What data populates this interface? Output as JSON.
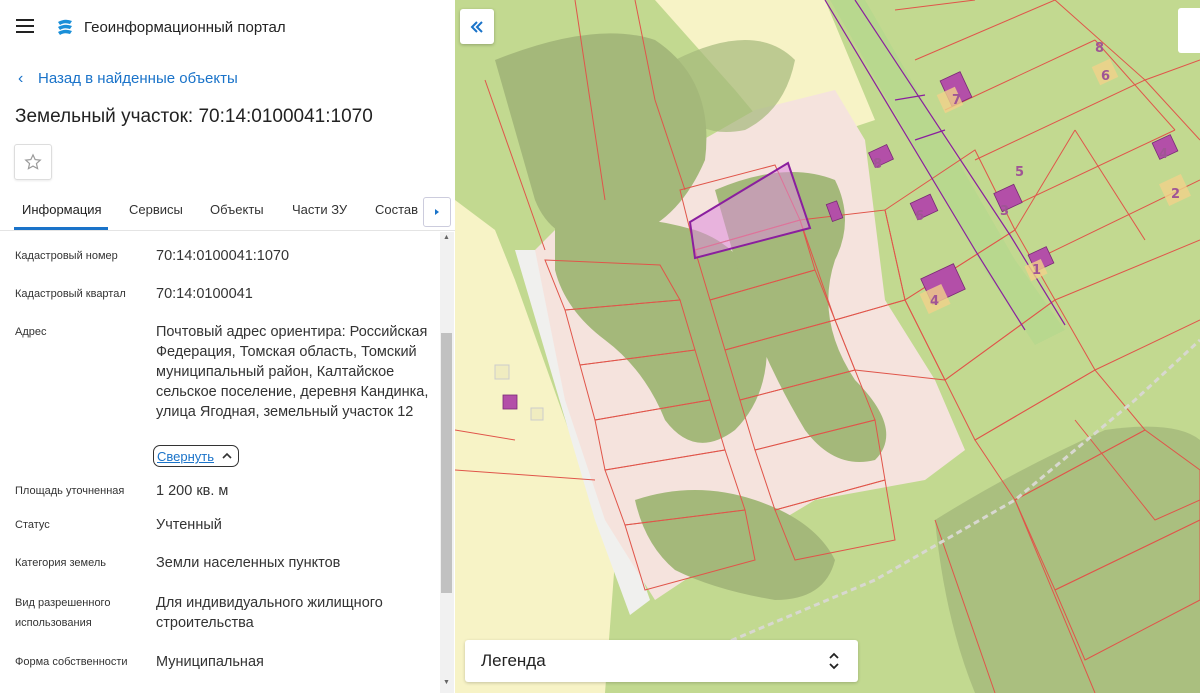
{
  "header": {
    "menu_icon": "hamburger-icon",
    "logo_icon": "portal-logo-icon",
    "title": "Геоинформационный портал"
  },
  "nav": {
    "back_label": "Назад в найденные объекты"
  },
  "object": {
    "title": "Земельный участок: 70:14:0100041:1070",
    "favorite_icon": "star-icon"
  },
  "tabs": [
    {
      "label": "Информация",
      "active": true
    },
    {
      "label": "Сервисы",
      "active": false
    },
    {
      "label": "Объекты",
      "active": false
    },
    {
      "label": "Части ЗУ",
      "active": false
    },
    {
      "label": "Состав",
      "active": false
    }
  ],
  "details": [
    {
      "label": "Кадастровый номер",
      "value": "70:14:0100041:1070"
    },
    {
      "label": "Кадастровый квартал",
      "value": "70:14:0100041"
    },
    {
      "label": "Адрес",
      "value": "Почтовый адрес ориентира: Российская Федерация, Томская область, Томский муниципальный район, Калтайское сельское поселение, деревня Кандинка, улица Ягодная, земельный участок 12"
    },
    {
      "label": "Площадь уточненная",
      "value": "1 200 кв. м"
    },
    {
      "label": "Статус",
      "value": "Учтенный"
    },
    {
      "label": "Категория земель",
      "value": "Земли населенных пунктов"
    },
    {
      "label": "Вид разрешенного использования",
      "value": "Для индивидуального жилищного строительства"
    },
    {
      "label": "Форма собственности",
      "value": "Муниципальная"
    }
  ],
  "address_toggle": "Свернуть",
  "map": {
    "parcel_numbers": [
      "8",
      "6",
      "7",
      "5",
      "2",
      "4",
      "3",
      "6",
      "1",
      "4",
      "8"
    ],
    "legend_label": "Легенда",
    "colors": {
      "green": "#c2d990",
      "dark_green": "#a4b87a",
      "pink": "#f5e3dd",
      "yellow": "#f7f3c6",
      "boundary": "#e0554a",
      "selected": "#8a1f9e",
      "building": "#b34fa8"
    }
  }
}
